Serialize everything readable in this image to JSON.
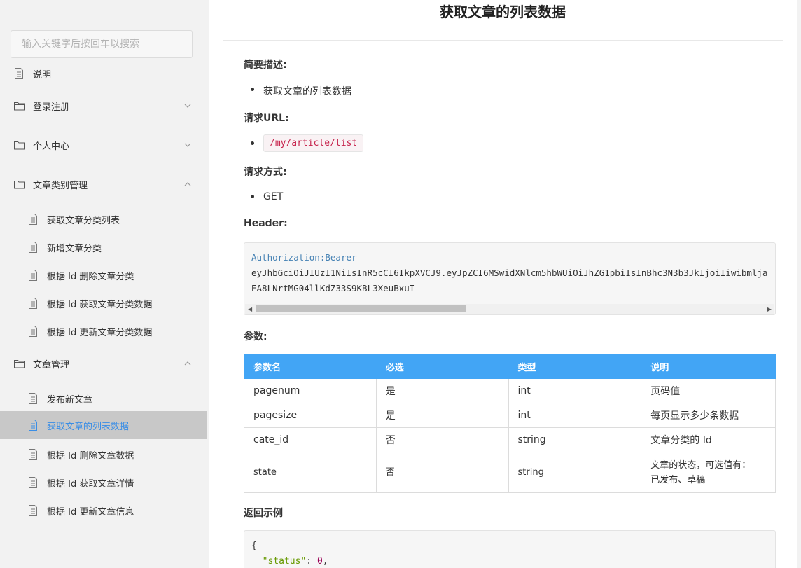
{
  "search": {
    "placeholder": "输入关键字后按回车以搜索"
  },
  "sidebar": {
    "items": [
      {
        "label": "说明"
      },
      {
        "label": "登录注册"
      },
      {
        "label": "个人中心"
      },
      {
        "label": "文章类别管理"
      },
      {
        "label": "获取文章分类列表"
      },
      {
        "label": "新增文章分类"
      },
      {
        "label": "根据 Id 删除文章分类"
      },
      {
        "label": "根据 Id 获取文章分类数据"
      },
      {
        "label": "根据 Id 更新文章分类数据"
      },
      {
        "label": "文章管理"
      },
      {
        "label": "发布新文章"
      },
      {
        "label": "获取文章的列表数据"
      },
      {
        "label": "根据 Id 删除文章数据"
      },
      {
        "label": "根据 Id 获取文章详情"
      },
      {
        "label": "根据 Id 更新文章信息"
      }
    ]
  },
  "main": {
    "title": "获取文章的列表数据",
    "desc_heading": "简要描述:",
    "desc_item": "获取文章的列表数据",
    "url_heading": "请求URL:",
    "url_value": "/my/article/list",
    "method_heading": "请求方式:",
    "method_value": "GET",
    "header_heading": "Header:",
    "header_code": {
      "key": "Authorization",
      "sep": ":",
      "value": "Bearer",
      "line2": "eyJhbGciOiJIUzI1NiIsInR5cCI6IkpXVCJ9.eyJpZCI6MSwidXNlcm5hbWUiOiJhZG1pbiIsInBhc3N3b3JkIjoiIiwibmlja",
      "line3": "EA8LNrtMG04llKdZ33S9KBL3XeuBxuI"
    },
    "params_heading": "参数:",
    "params_table": {
      "headers": [
        "参数名",
        "必选",
        "类型",
        "说明"
      ],
      "rows": [
        [
          "pagenum",
          "是",
          "int",
          "页码值"
        ],
        [
          "pagesize",
          "是",
          "int",
          "每页显示多少条数据"
        ],
        [
          "cate_id",
          "否",
          "string",
          "文章分类的 Id"
        ],
        [
          "state",
          "否",
          "string",
          "文章的状态，可选值有：",
          "已发布、草稿"
        ]
      ]
    },
    "return_heading": "返回示例",
    "return_code": {
      "line1": "{",
      "key": "\"status\"",
      "colon": ": ",
      "num": "0",
      "comma": ","
    }
  }
}
